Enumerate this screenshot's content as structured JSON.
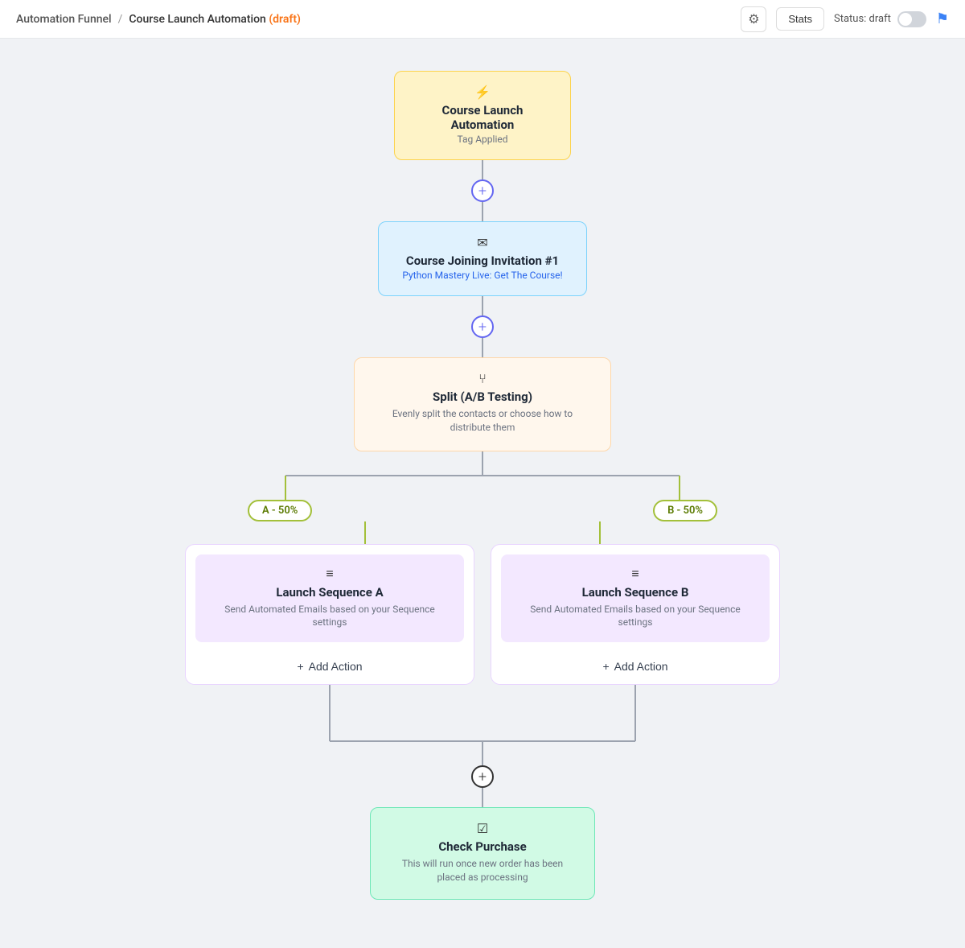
{
  "header": {
    "breadcrumb_funnel": "Automation Funnel",
    "breadcrumb_sep": "/",
    "breadcrumb_page": "Course Launch Automation",
    "breadcrumb_draft": "(draft)",
    "gear_icon": "⚙",
    "stats_label": "Stats",
    "status_label": "Status: draft",
    "flag_icon": "⚑"
  },
  "nodes": {
    "trigger": {
      "icon": "⚡",
      "title": "Course Launch Automation",
      "subtitle": "Tag Applied"
    },
    "email": {
      "icon": "✉",
      "title": "Course Joining Invitation #1",
      "subtitle": "Python Mastery Live: Get The Course!"
    },
    "split": {
      "icon": "⑂",
      "title": "Split (A/B Testing)",
      "subtitle": "Evenly split the contacts or choose how to distribute them"
    },
    "branch_a": {
      "label": "A - 50%"
    },
    "branch_b": {
      "label": "B - 50%"
    },
    "sequence_a": {
      "icon": "≡",
      "title": "Launch Sequence A",
      "subtitle": "Send Automated Emails based on your Sequence settings",
      "add_action": "Add Action"
    },
    "sequence_b": {
      "icon": "≡",
      "title": "Launch Sequence B",
      "subtitle": "Send Automated Emails based on your Sequence settings",
      "add_action": "Add Action"
    },
    "check": {
      "icon": "☑",
      "title": "Check Purchase",
      "subtitle": "This will run once new order has been placed as processing"
    }
  }
}
